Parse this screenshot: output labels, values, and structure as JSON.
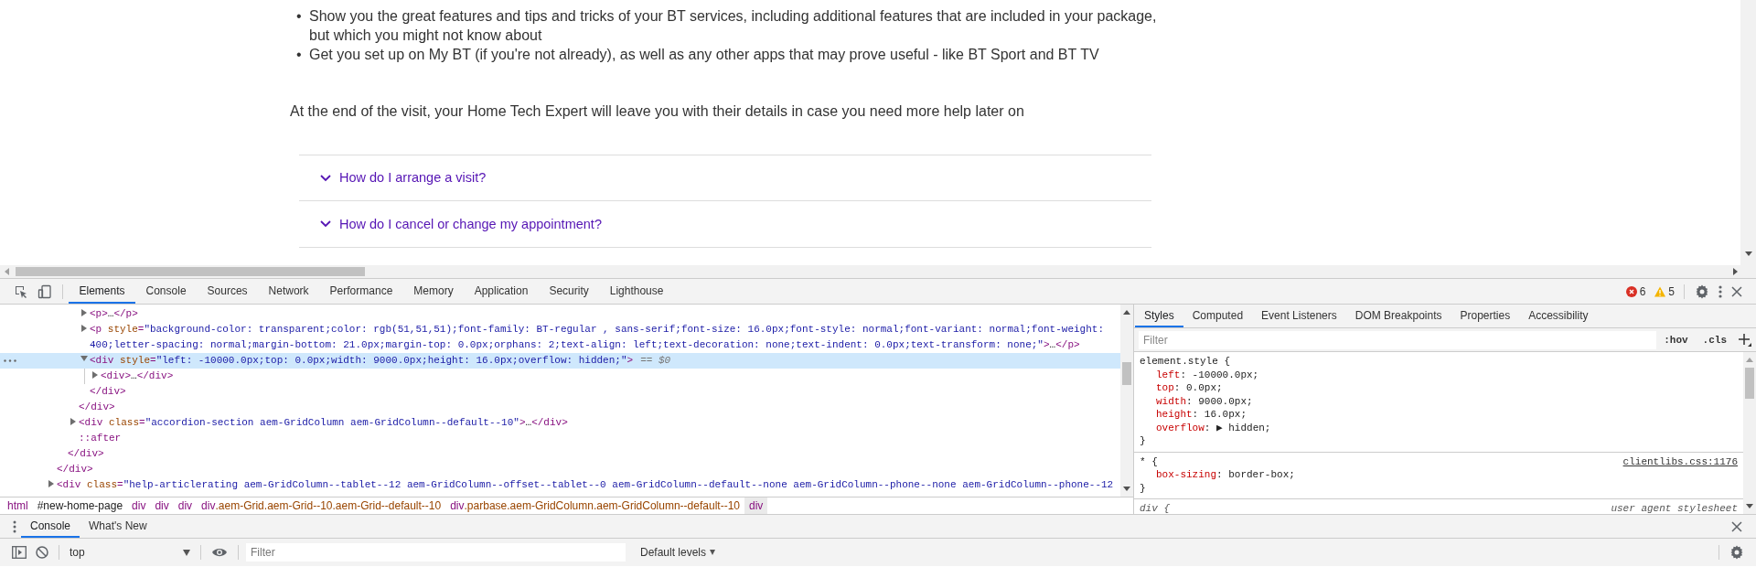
{
  "page": {
    "list_items": [
      {
        "marker": "•",
        "text": "Show you the great features and tips and tricks of your BT services, including additional features that are included in your package, but which you might not know about"
      },
      {
        "marker": "•",
        "text": "Get you set up on My BT (if you're not already), as well as any other apps that may prove useful - like BT Sport and BT TV"
      }
    ],
    "paragraph": "At the end of the visit, your Home Tech Expert will leave you with their details in case you need more help later on",
    "accordion": [
      {
        "question": "How do I arrange a visit?",
        "expanded": false
      },
      {
        "question": "How do I cancel or change my appointment?",
        "expanded": false
      }
    ]
  },
  "devtools": {
    "panel_tabs": [
      {
        "label": "Elements",
        "selected": true
      },
      {
        "label": "Console",
        "selected": false
      },
      {
        "label": "Sources",
        "selected": false
      },
      {
        "label": "Network",
        "selected": false
      },
      {
        "label": "Performance",
        "selected": false
      },
      {
        "label": "Memory",
        "selected": false
      },
      {
        "label": "Application",
        "selected": false
      },
      {
        "label": "Security",
        "selected": false
      },
      {
        "label": "Lighthouse",
        "selected": false
      }
    ],
    "issues": {
      "errors": "6",
      "warnings": "5"
    },
    "dom_tree": [
      {
        "closing": "</div>",
        "children": [
          {
            "closing": "</div>",
            "children": [
              {
                "closing": "</div>",
                "children": [
                  {
                    "kind": "element",
                    "markup": "<p>…</p>",
                    "expanded": false,
                    "selected": false
                  },
                  {
                    "kind": "element",
                    "markup": "<p style=\"background-color: transparent;color: rgb(51,51,51);font-family: BT-regular , sans-serif;font-size: 16.0px;font-style: normal;font-variant: normal;font-weight: 400;letter-spacing: normal;margin-bottom: 21.0px;margin-top: 0.0px;orphans: 2;text-align: left;text-decoration: none;text-indent: 0.0px;text-transform: none;\">…</p>",
                    "expanded": false,
                    "selected": false
                  },
                  {
                    "kind": "element",
                    "markup": "<div style=\"left: -10000.0px;top: 0.0px;width: 9000.0px;height: 16.0px;overflow: hidden;\">",
                    "suffix": "== $0",
                    "expanded": true,
                    "selected": true,
                    "closing": "</div>",
                    "children": [
                      {
                        "kind": "element",
                        "markup": "<div>…</div>",
                        "expanded": false,
                        "selected": false
                      }
                    ]
                  }
                ]
              },
              {
                "kind": "element",
                "markup": "<div class=\"accordion-section aem-GridColumn aem-GridColumn--default--10\">…</div>",
                "expanded": false,
                "selected": false
              },
              {
                "kind": "pseudo",
                "markup": "::after",
                "selected": false
              }
            ]
          }
        ]
      },
      {
        "kind": "element",
        "markup": "<div class=\"help-articlerating aem-GridColumn--tablet--12 aem-GridColumn--offset--tablet--0 aem-GridColumn--default--none aem-GridColumn--phone--none aem-GridColumn--phone--12",
        "expanded": false,
        "selected": false
      }
    ],
    "breadcrumbs": [
      {
        "label": "html",
        "selected": false
      },
      {
        "label": "#new-home-page",
        "selected": false
      },
      {
        "label": "div",
        "selected": false
      },
      {
        "label": "div",
        "selected": false
      },
      {
        "label": "div",
        "selected": false
      },
      {
        "label": "div.aem-Grid.aem-Grid--10.aem-Grid--default--10",
        "selected": false
      },
      {
        "label": "div.parbase.aem-GridColumn.aem-GridColumn--default--10",
        "selected": false
      },
      {
        "label": "div",
        "selected": true
      }
    ],
    "sidebar_tabs": [
      {
        "label": "Styles",
        "selected": true
      },
      {
        "label": "Computed",
        "selected": false
      },
      {
        "label": "Event Listeners",
        "selected": false
      },
      {
        "label": "DOM Breakpoints",
        "selected": false
      },
      {
        "label": "Properties",
        "selected": false
      },
      {
        "label": "Accessibility",
        "selected": false
      }
    ],
    "styles_filter": {
      "placeholder": "Filter"
    },
    "styles_buttons": [
      ":hov",
      ".cls"
    ],
    "style_rules": [
      {
        "kind": "inline",
        "selector": "element.style {",
        "declarations": [
          "left: -10000.0px;",
          "top: 0.0px;",
          "width: 9000.0px;",
          "height: 16.0px;",
          "overflow: ▶ hidden;"
        ],
        "closing": "}"
      },
      {
        "kind": "author",
        "selector": "* {",
        "source": "clientlibs.css:1176",
        "declarations": [
          "box-sizing: border-box;"
        ],
        "closing": "}"
      },
      {
        "kind": "user-agent",
        "selector": "div {",
        "source": "user agent stylesheet"
      }
    ],
    "drawer_tabs": [
      {
        "label": "Console",
        "selected": true
      },
      {
        "label": "What's New",
        "selected": false
      }
    ],
    "console": {
      "context": "top",
      "filter_placeholder": "Filter",
      "levels": "Default levels"
    }
  }
}
